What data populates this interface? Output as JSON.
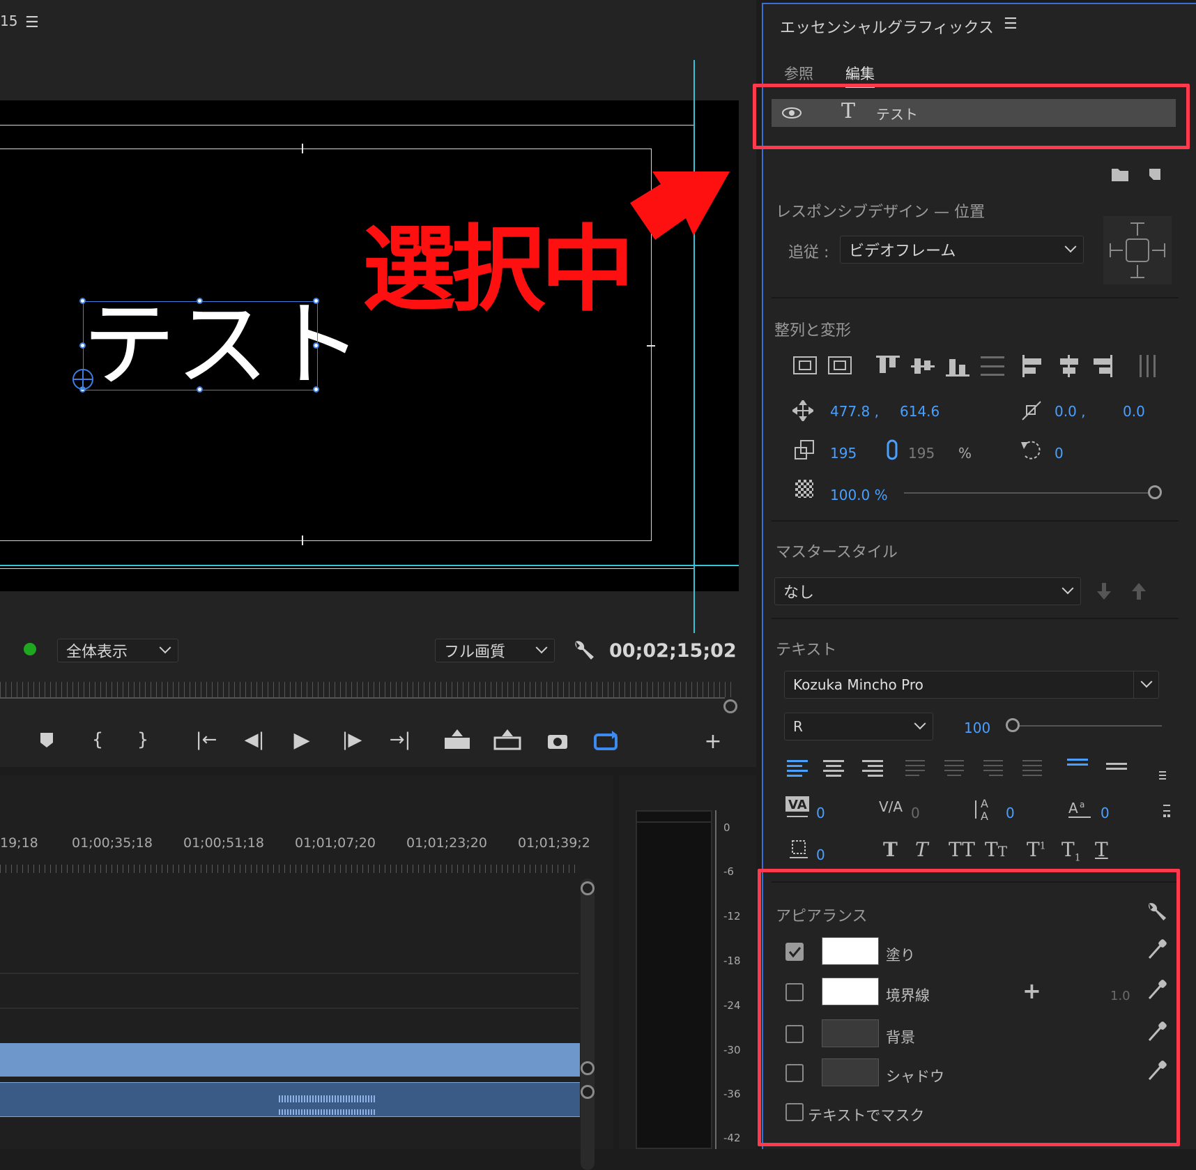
{
  "monitor": {
    "timecode_fragment": "15",
    "title_text": "テスト",
    "annotation": "選択中",
    "fit_label": "全体表示",
    "quality_label": "フル画質",
    "timecode": "00;02;15;02"
  },
  "timeline": {
    "timecodes": [
      "19;18",
      "01;00;35;18",
      "01;00;51;18",
      "01;01;07;20",
      "01;01;23;20",
      "01;01;39;2"
    ]
  },
  "meter": {
    "levels": [
      "0",
      "-6",
      "-12",
      "-18",
      "-24",
      "-30",
      "-36",
      "-42"
    ]
  },
  "panel": {
    "title": "エッセンシャルグラフィックス",
    "tab_browse": "参照",
    "tab_edit": "編集",
    "layer_name": "テスト",
    "responsive_heading": "レスポンシブデザイン — 位置",
    "follow_label": "追従 :",
    "follow_value": "ビデオフレーム",
    "align_heading": "整列と変形",
    "pos_x": "477.8 ,",
    "pos_y": "614.6",
    "anchor_x": "0.0 ,",
    "anchor_y": "0.0",
    "scale": "195",
    "scale_linked": "195",
    "percent": "%",
    "rotation": "0",
    "opacity": "100.0 %",
    "master_heading": "マスタースタイル",
    "master_value": "なし",
    "text_heading": "テキスト",
    "font_family": "Kozuka Mincho Pro",
    "font_style": "R",
    "font_size": "100",
    "kerning": "0",
    "tracking": "0",
    "leading": "0",
    "baseline": "0",
    "tsume": "0",
    "appearance_heading": "アピアランス",
    "fill_label": "塗り",
    "stroke_label": "境界線",
    "stroke_width": "1.0",
    "bg_label": "背景",
    "shadow_label": "シャドウ",
    "mask_label": "テキストでマスク"
  },
  "colors": {
    "accent_blue": "#4aa0ff",
    "guide_cyan": "#34c6d8",
    "highlight_red": "#ff3a4e",
    "annotation_red": "#ff1010"
  }
}
